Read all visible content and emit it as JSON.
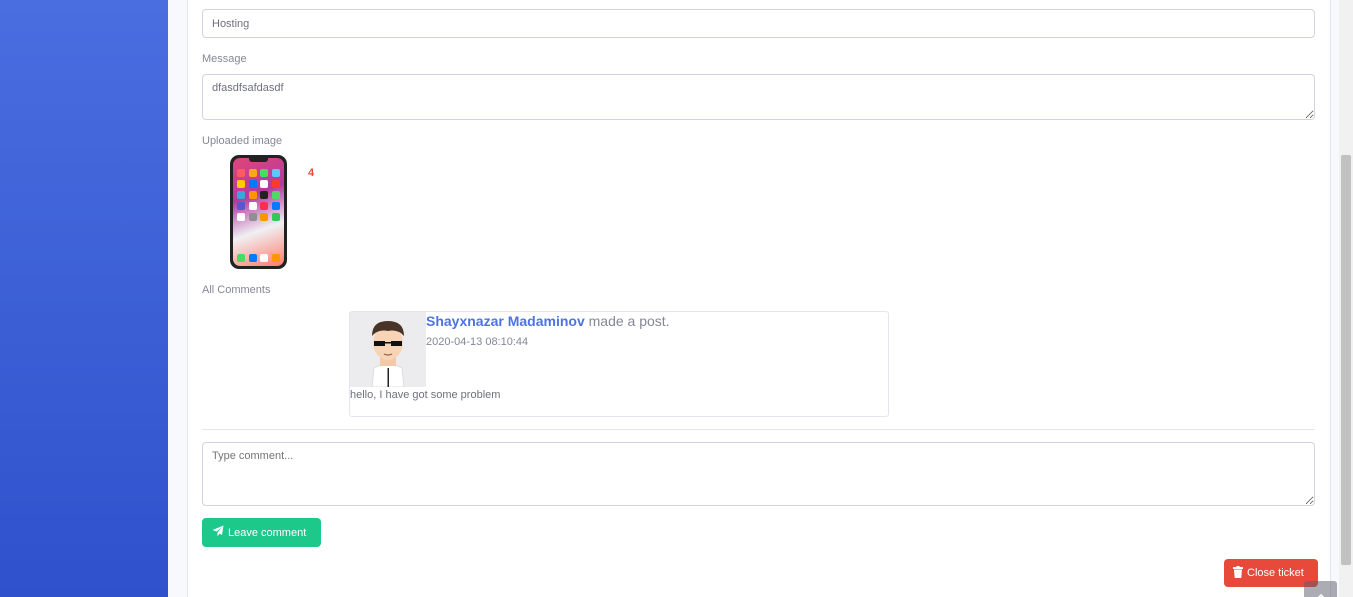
{
  "form": {
    "subject_value": "Hosting",
    "message_label": "Message",
    "message_value": "dfasdfsafdasdf",
    "uploaded_image_label": "Uploaded image",
    "image_count": "4",
    "all_comments_label": "All Comments"
  },
  "comments": [
    {
      "author": "Shayxnazar Madaminov",
      "action": "made a post.",
      "date": "2020-04-13 08:10:44",
      "text": "hello, I have got some problem"
    }
  ],
  "reply": {
    "placeholder": "Type comment...",
    "submit_label": "Leave comment"
  },
  "actions": {
    "close_label": "Close ticket"
  },
  "colors": {
    "sidebar_gradient_top": "#4a6ee0",
    "sidebar_gradient_bottom": "#2f51cc",
    "primary": "#4e73df",
    "success": "#1cc88a",
    "danger": "#e74a3b"
  }
}
